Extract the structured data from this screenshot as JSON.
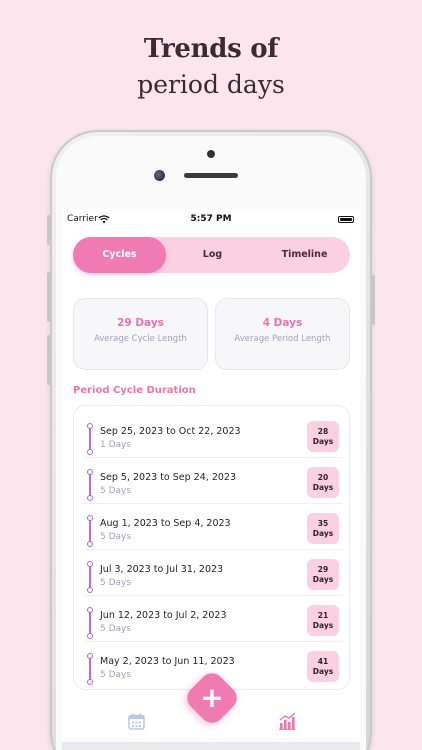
{
  "headline": {
    "line1": "Trends of",
    "line2": "period days"
  },
  "status_bar": {
    "carrier": "Carrier",
    "time": "5:57 PM"
  },
  "segmented": {
    "tabs": [
      "Cycles",
      "Log",
      "Timeline"
    ],
    "active": "Cycles"
  },
  "stats": [
    {
      "value": "29 Days",
      "label": "Average Cycle Length"
    },
    {
      "value": "4 Days",
      "label": "Average Period Length"
    }
  ],
  "section_title": "Period Cycle Duration",
  "cycles": [
    {
      "range": "Sep 25, 2023 to Oct 22, 2023",
      "period": "1 Days",
      "length_value": "28",
      "length_unit": "Days"
    },
    {
      "range": "Sep 5, 2023 to Sep 24, 2023",
      "period": "5 Days",
      "length_value": "20",
      "length_unit": "Days"
    },
    {
      "range": "Aug 1, 2023 to Sep 4, 2023",
      "period": "5 Days",
      "length_value": "35",
      "length_unit": "Days"
    },
    {
      "range": "Jul 3, 2023 to Jul 31, 2023",
      "period": "5 Days",
      "length_value": "29",
      "length_unit": "Days"
    },
    {
      "range": "Jun 12, 2023 to Jul 2, 2023",
      "period": "5 Days",
      "length_value": "21",
      "length_unit": "Days"
    },
    {
      "range": "May 2, 2023 to Jun 11, 2023",
      "period": "5 Days",
      "length_value": "41",
      "length_unit": "Days"
    }
  ],
  "fab": {
    "label": "+"
  },
  "tab_bar": {
    "icons": [
      "calendar-icon",
      "bar-chart-icon"
    ]
  },
  "colors": {
    "accent": "#f07ab2",
    "accent_light": "#fbd0e1",
    "background": "#fbe6ee",
    "muted_text": "#a6a0b6"
  }
}
